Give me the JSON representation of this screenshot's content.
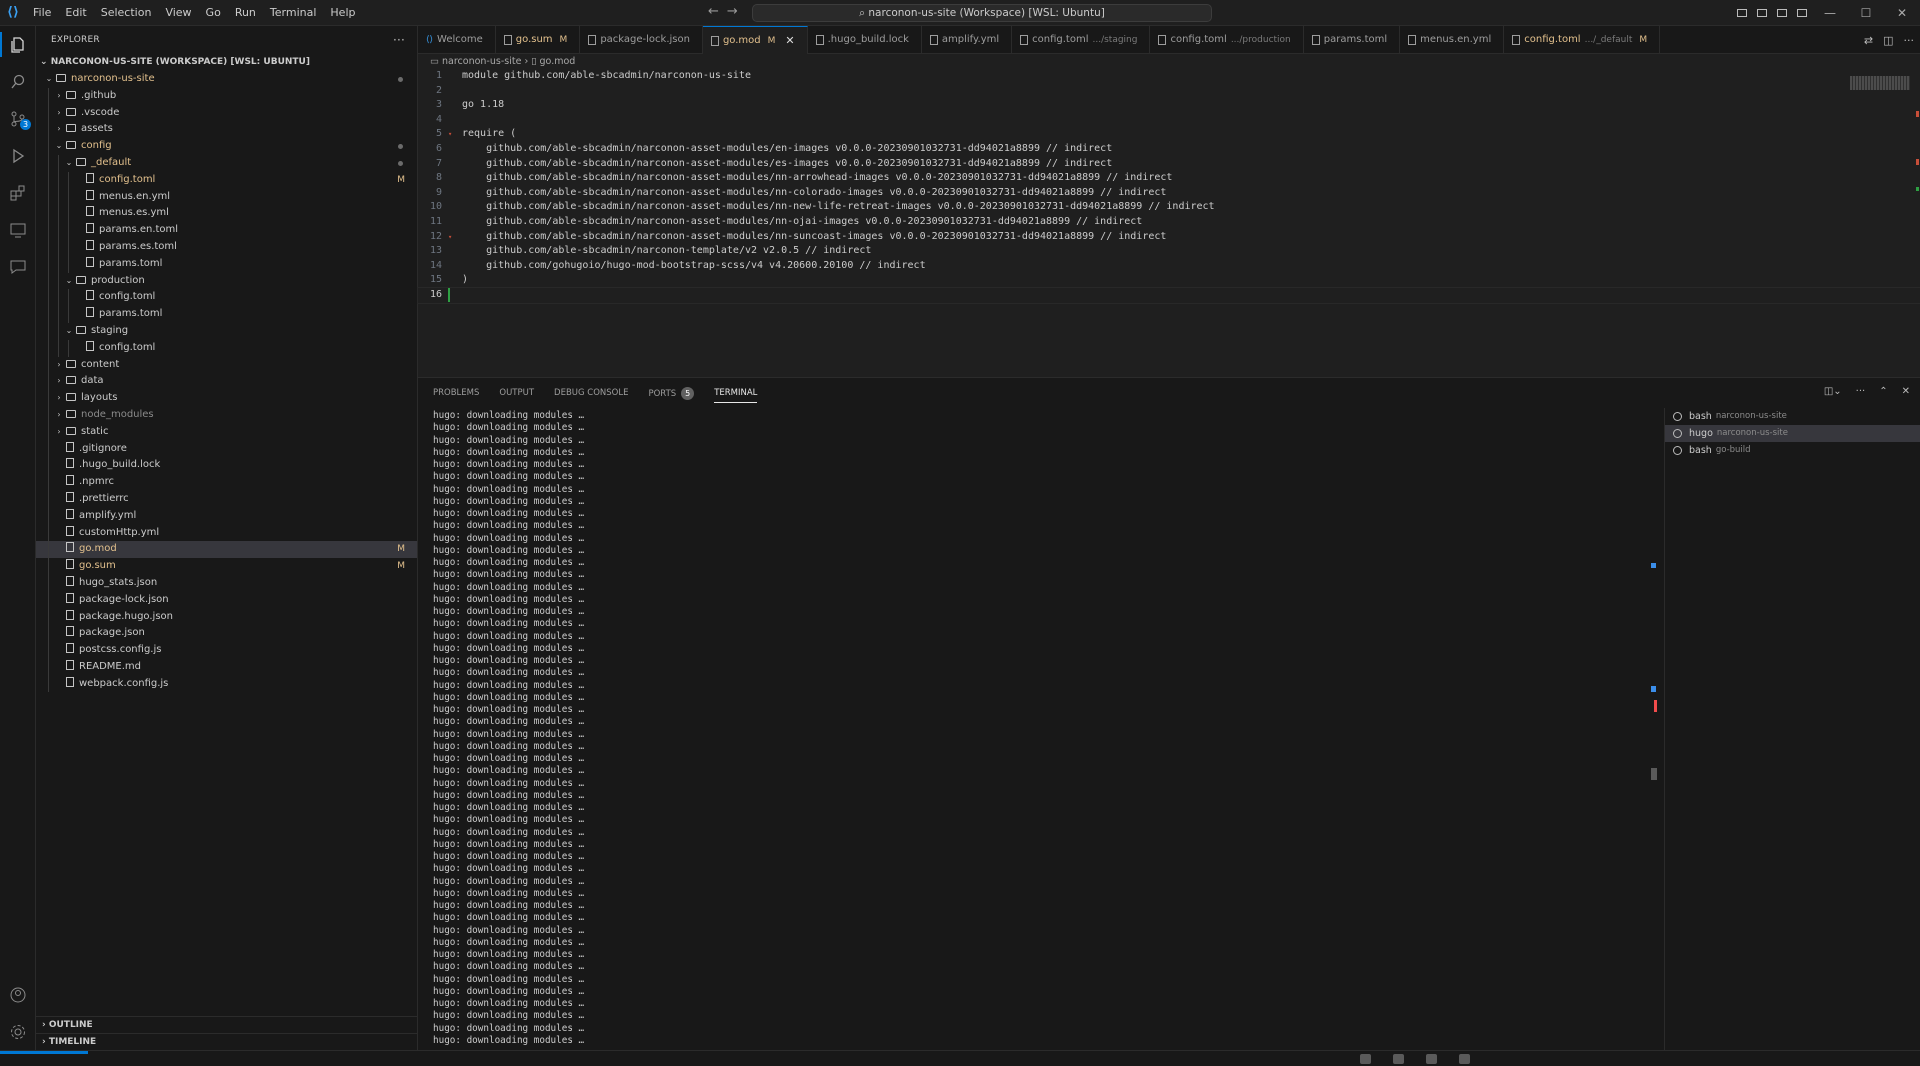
{
  "titlebar": {
    "menu": [
      "File",
      "Edit",
      "Selection",
      "View",
      "Go",
      "Run",
      "Terminal",
      "Help"
    ],
    "command_center": "narconon-us-site (Workspace) [WSL: Ubuntu]"
  },
  "activity": {
    "source_control_badge": "3"
  },
  "explorer": {
    "title": "EXPLORER",
    "workspace": "NARCONON-US-SITE (WORKSPACE) [WSL: UBUNTU]",
    "rows": [
      {
        "label": "narconon-us-site",
        "depth": 0,
        "kind": "folder-open",
        "status": "dot",
        "color": "mod"
      },
      {
        "label": ".github",
        "depth": 1,
        "kind": "folder",
        "status": "",
        "color": ""
      },
      {
        "label": ".vscode",
        "depth": 1,
        "kind": "folder",
        "status": "",
        "color": ""
      },
      {
        "label": "assets",
        "depth": 1,
        "kind": "folder",
        "status": "",
        "color": ""
      },
      {
        "label": "config",
        "depth": 1,
        "kind": "folder-open",
        "status": "dot",
        "color": "mod"
      },
      {
        "label": "_default",
        "depth": 2,
        "kind": "folder-open",
        "status": "dot",
        "color": "mod"
      },
      {
        "label": "config.toml",
        "depth": 3,
        "kind": "file",
        "status": "M",
        "color": "mod"
      },
      {
        "label": "menus.en.yml",
        "depth": 3,
        "kind": "file",
        "status": "",
        "color": ""
      },
      {
        "label": "menus.es.yml",
        "depth": 3,
        "kind": "file",
        "status": "",
        "color": ""
      },
      {
        "label": "params.en.toml",
        "depth": 3,
        "kind": "file",
        "status": "",
        "color": ""
      },
      {
        "label": "params.es.toml",
        "depth": 3,
        "kind": "file",
        "status": "",
        "color": ""
      },
      {
        "label": "params.toml",
        "depth": 3,
        "kind": "file",
        "status": "",
        "color": ""
      },
      {
        "label": "production",
        "depth": 2,
        "kind": "folder-open",
        "status": "",
        "color": ""
      },
      {
        "label": "config.toml",
        "depth": 3,
        "kind": "file",
        "status": "",
        "color": ""
      },
      {
        "label": "params.toml",
        "depth": 3,
        "kind": "file",
        "status": "",
        "color": ""
      },
      {
        "label": "staging",
        "depth": 2,
        "kind": "folder-open",
        "status": "",
        "color": ""
      },
      {
        "label": "config.toml",
        "depth": 3,
        "kind": "file",
        "status": "",
        "color": ""
      },
      {
        "label": "content",
        "depth": 1,
        "kind": "folder",
        "status": "",
        "color": ""
      },
      {
        "label": "data",
        "depth": 1,
        "kind": "folder",
        "status": "",
        "color": ""
      },
      {
        "label": "layouts",
        "depth": 1,
        "kind": "folder",
        "status": "",
        "color": ""
      },
      {
        "label": "node_modules",
        "depth": 1,
        "kind": "folder",
        "status": "",
        "color": "dim"
      },
      {
        "label": "static",
        "depth": 1,
        "kind": "folder",
        "status": "",
        "color": ""
      },
      {
        "label": ".gitignore",
        "depth": 1,
        "kind": "file",
        "status": "",
        "color": ""
      },
      {
        "label": ".hugo_build.lock",
        "depth": 1,
        "kind": "file",
        "status": "",
        "color": ""
      },
      {
        "label": ".npmrc",
        "depth": 1,
        "kind": "file",
        "status": "",
        "color": ""
      },
      {
        "label": ".prettierrc",
        "depth": 1,
        "kind": "file",
        "status": "",
        "color": ""
      },
      {
        "label": "amplify.yml",
        "depth": 1,
        "kind": "file",
        "status": "",
        "color": ""
      },
      {
        "label": "customHttp.yml",
        "depth": 1,
        "kind": "file",
        "status": "",
        "color": ""
      },
      {
        "label": "go.mod",
        "depth": 1,
        "kind": "file",
        "status": "M",
        "color": "mod",
        "selected": true
      },
      {
        "label": "go.sum",
        "depth": 1,
        "kind": "file",
        "status": "M",
        "color": "mod"
      },
      {
        "label": "hugo_stats.json",
        "depth": 1,
        "kind": "file",
        "status": "",
        "color": ""
      },
      {
        "label": "package-lock.json",
        "depth": 1,
        "kind": "file",
        "status": "",
        "color": ""
      },
      {
        "label": "package.hugo.json",
        "depth": 1,
        "kind": "file",
        "status": "",
        "color": ""
      },
      {
        "label": "package.json",
        "depth": 1,
        "kind": "file",
        "status": "",
        "color": ""
      },
      {
        "label": "postcss.config.js",
        "depth": 1,
        "kind": "file",
        "status": "",
        "color": ""
      },
      {
        "label": "README.md",
        "depth": 1,
        "kind": "file",
        "status": "",
        "color": ""
      },
      {
        "label": "webpack.config.js",
        "depth": 1,
        "kind": "file",
        "status": "",
        "color": ""
      }
    ],
    "outline": "OUTLINE",
    "timeline": "TIMELINE"
  },
  "tabs": [
    {
      "label": "Welcome",
      "sub": "",
      "status": "",
      "active": false
    },
    {
      "label": "go.sum",
      "sub": "",
      "status": "M",
      "active": false
    },
    {
      "label": "package-lock.json",
      "sub": "",
      "status": "",
      "active": false
    },
    {
      "label": "go.mod",
      "sub": "",
      "status": "M",
      "active": true
    },
    {
      "label": ".hugo_build.lock",
      "sub": "",
      "status": "",
      "active": false
    },
    {
      "label": "amplify.yml",
      "sub": "",
      "status": "",
      "active": false
    },
    {
      "label": "config.toml",
      "sub": ".../staging",
      "status": "",
      "active": false
    },
    {
      "label": "config.toml",
      "sub": ".../production",
      "status": "",
      "active": false
    },
    {
      "label": "params.toml",
      "sub": "",
      "status": "",
      "active": false
    },
    {
      "label": "menus.en.yml",
      "sub": "",
      "status": "",
      "active": false
    },
    {
      "label": "config.toml",
      "sub": ".../_default",
      "status": "M",
      "active": false
    }
  ],
  "breadcrumb": {
    "folder": "narconon-us-site",
    "file": "go.mod"
  },
  "code_lines": [
    "module github.com/able-sbcadmin/narconon-us-site",
    "",
    "go 1.18",
    "",
    "require (",
    "\tgithub.com/able-sbcadmin/narconon-asset-modules/en-images v0.0.0-20230901032731-dd94021a8899 // indirect",
    "\tgithub.com/able-sbcadmin/narconon-asset-modules/es-images v0.0.0-20230901032731-dd94021a8899 // indirect",
    "\tgithub.com/able-sbcadmin/narconon-asset-modules/nn-arrowhead-images v0.0.0-20230901032731-dd94021a8899 // indirect",
    "\tgithub.com/able-sbcadmin/narconon-asset-modules/nn-colorado-images v0.0.0-20230901032731-dd94021a8899 // indirect",
    "\tgithub.com/able-sbcadmin/narconon-asset-modules/nn-new-life-retreat-images v0.0.0-20230901032731-dd94021a8899 // indirect",
    "\tgithub.com/able-sbcadmin/narconon-asset-modules/nn-ojai-images v0.0.0-20230901032731-dd94021a8899 // indirect",
    "\tgithub.com/able-sbcadmin/narconon-asset-modules/nn-suncoast-images v0.0.0-20230901032731-dd94021a8899 // indirect",
    "\tgithub.com/able-sbcadmin/narconon-template/v2 v2.0.5 // indirect",
    "\tgithub.com/gohugoio/hugo-mod-bootstrap-scss/v4 v4.20600.20100 // indirect",
    ")",
    ""
  ],
  "current_line": 16,
  "panel": {
    "tabs": [
      "PROBLEMS",
      "OUTPUT",
      "DEBUG CONSOLE",
      "PORTS",
      "TERMINAL"
    ],
    "ports_count": "5",
    "active_tab": "TERMINAL",
    "terminal_line": "hugo: downloading modules …",
    "terminal_line_count": 52,
    "terminals": [
      {
        "name": "bash",
        "sub": "narconon-us-site",
        "active": false
      },
      {
        "name": "hugo",
        "sub": "narconon-us-site",
        "active": true
      },
      {
        "name": "bash",
        "sub": "go-build",
        "active": false
      }
    ]
  },
  "colors": {
    "accent": "#0078d4",
    "modified": "#e2c08d",
    "background": "#1f1f1f"
  },
  "icons": [
    "files-icon",
    "search-icon",
    "source-control-icon",
    "run-debug-icon",
    "extensions-icon",
    "remote-explorer-icon",
    "chat-icon",
    "account-icon",
    "settings-gear-icon"
  ]
}
